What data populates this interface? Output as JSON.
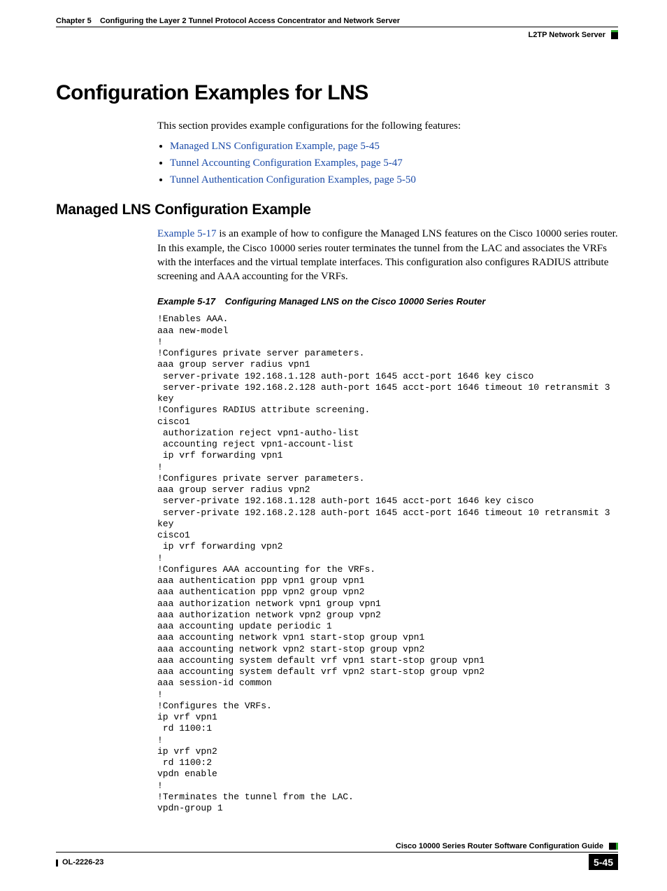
{
  "header": {
    "chapter_label": "Chapter 5",
    "chapter_title": "Configuring the Layer 2 Tunnel Protocol Access Concentrator and Network Server",
    "section": "L2TP Network Server"
  },
  "h1": "Configuration Examples for LNS",
  "intro": "This section provides example configurations for the following features:",
  "links": [
    "Managed LNS Configuration Example, page 5-45",
    "Tunnel Accounting Configuration Examples, page 5-47",
    "Tunnel Authentication Configuration Examples, page 5-50"
  ],
  "h2": "Managed LNS Configuration Example",
  "para2_link": "Example 5-17",
  "para2_rest": " is an example of how to configure the Managed LNS features on the Cisco 10000 series router. In this example, the Cisco 10000 series router terminates the tunnel from the LAC and associates the VRFs with the interfaces and the virtual template interfaces. This configuration also configures RADIUS attribute screening and AAA accounting for the VRFs.",
  "example_label": "Example 5-17",
  "example_title": "Configuring Managed LNS on the Cisco 10000 Series Router",
  "code": "!Enables AAA.\naaa new-model\n!\n!Configures private server parameters.\naaa group server radius vpn1\n server-private 192.168.1.128 auth-port 1645 acct-port 1646 key cisco\n server-private 192.168.2.128 auth-port 1645 acct-port 1646 timeout 10 retransmit 3 key \n!Configures RADIUS attribute screening.\ncisco1\n authorization reject vpn1-autho-list\n accounting reject vpn1-account-list\n ip vrf forwarding vpn1\n!\n!Configures private server parameters.\naaa group server radius vpn2\n server-private 192.168.1.128 auth-port 1645 acct-port 1646 key cisco\n server-private 192.168.2.128 auth-port 1645 acct-port 1646 timeout 10 retransmit 3 key \ncisco1\n ip vrf forwarding vpn2\n!\n!Configures AAA accounting for the VRFs.\naaa authentication ppp vpn1 group vpn1\naaa authentication ppp vpn2 group vpn2\naaa authorization network vpn1 group vpn1\naaa authorization network vpn2 group vpn2\naaa accounting update periodic 1\naaa accounting network vpn1 start-stop group vpn1\naaa accounting network vpn2 start-stop group vpn2\naaa accounting system default vrf vpn1 start-stop group vpn1\naaa accounting system default vrf vpn2 start-stop group vpn2\naaa session-id common\n!\n!Configures the VRFs.\nip vrf vpn1\n rd 1100:1\n!\nip vrf vpn2\n rd 1100:2\nvpdn enable\n!\n!Terminates the tunnel from the LAC.\nvpdn-group 1",
  "footer": {
    "book": "Cisco 10000 Series Router Software Configuration Guide",
    "doc_id": "OL-2226-23",
    "page_num": "5-45"
  }
}
